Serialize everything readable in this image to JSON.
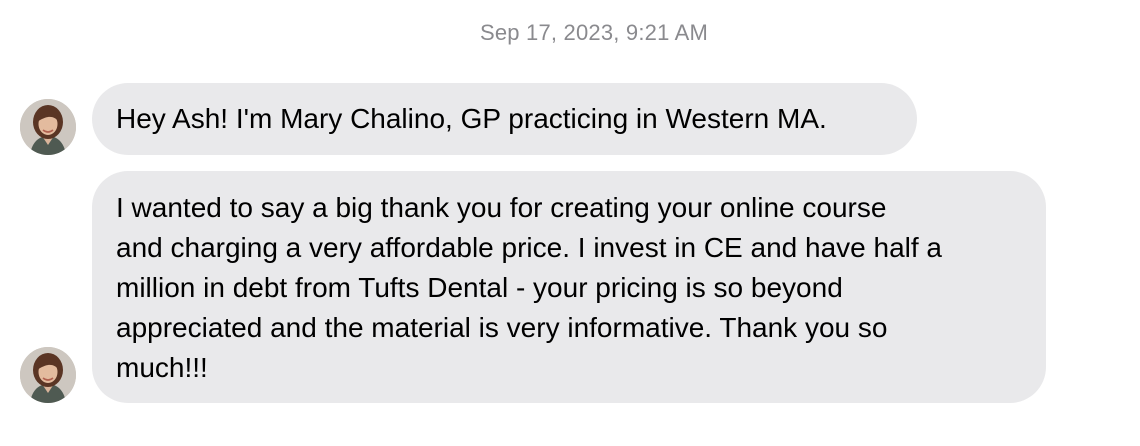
{
  "thread": {
    "timestamp": "Sep 17, 2023, 9:21 AM"
  },
  "messages": [
    {
      "sender_avatar": "contact-avatar",
      "text": "Hey Ash! I'm Mary Chalino, GP practicing in Western MA."
    },
    {
      "sender_avatar": "contact-avatar",
      "lines": [
        "I wanted to say a big thank you for creating your online course",
        "and charging a very affordable price. I invest in CE and have half a",
        "million in debt from Tufts Dental - your pricing is so beyond",
        "appreciated and the material is very informative. Thank you so",
        "much!!!"
      ]
    }
  ],
  "colors": {
    "incoming_bubble": "#e9e9eb",
    "timestamp_text": "#8a8a8e",
    "message_text": "#000000"
  }
}
